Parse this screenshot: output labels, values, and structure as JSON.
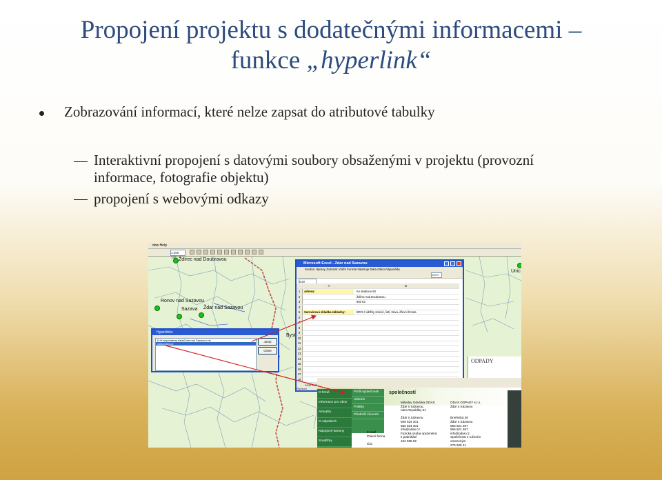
{
  "slide": {
    "title_line1": "Propojení projektu s dodatečnými informacemi –",
    "title_line2_prefix": "funkce ",
    "title_line2_italic": "„hyperlink“",
    "bullet1": "Zobrazování informací, které nelze zapsat do atributové tabulky",
    "sub1_line1": "Interaktivní propojení s datovými soubory obsaženými v projektu (provozní",
    "sub1_line2": "informace, fotografie objektu)",
    "sub2": "propojení s webovými odkazy"
  },
  "screenshot": {
    "map_menu": "dow   Help",
    "scale": "1:266 749",
    "places": {
      "zdirec": "Ždírec nad Doubravou",
      "ronov": "Ronov nad Sazavou",
      "sazava": "Sazava",
      "zdar": "Ždar nad Sazavou",
      "bys": "Byst",
      "unic": "Unic"
    },
    "excel": {
      "title": "Microsoft Excel - Zdar nad Sazavou",
      "menu": "Soubor  Úpravy  Zobrazit  Vložit  Formát  Nástroje  Data  Okno  Nápověda",
      "cellref": "B19",
      "zoom": "100%",
      "col_a": "A",
      "col_b": "B",
      "rows": [
        {
          "n": "1",
          "a": "Adresa:",
          "b": "Ke stadionu 50"
        },
        {
          "n": "2",
          "a": "",
          "b": "Ždírec nad Doubravou"
        },
        {
          "n": "3",
          "a": "",
          "b": "582 63"
        },
        {
          "n": "4",
          "a": "",
          "b": ""
        },
        {
          "n": "5",
          "a": "Surovinová skladba základny:",
          "b": "BRO z údržby zeleně, listí, tráva, dřevní hmota"
        },
        {
          "n": "6",
          "a": "",
          "b": ""
        },
        {
          "n": "7",
          "a": "",
          "b": ""
        },
        {
          "n": "8",
          "a": "",
          "b": ""
        },
        {
          "n": "9",
          "a": "",
          "b": ""
        },
        {
          "n": "10",
          "a": "",
          "b": ""
        },
        {
          "n": "11",
          "a": "",
          "b": ""
        },
        {
          "n": "12",
          "a": "",
          "b": ""
        },
        {
          "n": "13",
          "a": "",
          "b": ""
        },
        {
          "n": "14",
          "a": "",
          "b": ""
        },
        {
          "n": "15",
          "a": "",
          "b": ""
        },
        {
          "n": "16",
          "a": "",
          "b": ""
        },
        {
          "n": "17",
          "a": "",
          "b": ""
        },
        {
          "n": "18",
          "a": "",
          "b": ""
        }
      ],
      "tabs": "List1  List2  List3",
      "status": "Připraven",
      "status_num": "123"
    },
    "hyperlink": {
      "title": "Hyperlinks",
      "item1": "D:\\Kompostarny-data\\Zdar nad Sazavou.xls",
      "item2": "www.odas.cz",
      "jump": "Jump",
      "close": "Close"
    },
    "web": {
      "header_partial": "společností",
      "brand": "ODPADY",
      "nav": [
        "O firmě",
        "Informace pro obce",
        "Aktuality",
        "O odpadech",
        "Nápojové kartony",
        "Soutěžsy"
      ],
      "sub": [
        "Profil společnosti",
        "Historie",
        "Politiky",
        "Předmět činnosti"
      ],
      "col1": [
        "E-mail",
        "Právní forma",
        "",
        "IČO"
      ],
      "col2": [
        "Miloslav Odvárka ODAS",
        "Ždár n.Sázavou,",
        "nám.Republiky 61",
        "",
        "Ždár n.Sázavou",
        "566 624 301",
        "566 624 301",
        "info@odas.cz",
        "Fyzická osoba oprávněná",
        "k podnikání",
        "152 598 92"
      ],
      "col3": [
        "ODAS ODPADY s.r.o.",
        "Ždár n.Sázavou",
        "",
        "",
        "Brněnská 48",
        "Ždár n.Sázavou",
        "566 621 267",
        "566 621 267",
        "info@odas.cz",
        "Společnost s ručením",
        "omezeným",
        "276 928 41"
      ]
    }
  }
}
